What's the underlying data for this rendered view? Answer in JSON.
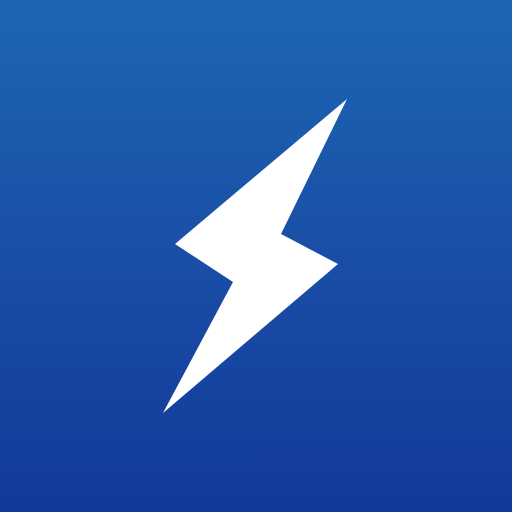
{
  "icon": {
    "name": "lightning-bolt-icon",
    "background_top": "#1c67b3",
    "background_mid": "#1a4ea6",
    "background_bottom": "#12399a",
    "bolt_color": "#ffffff"
  }
}
